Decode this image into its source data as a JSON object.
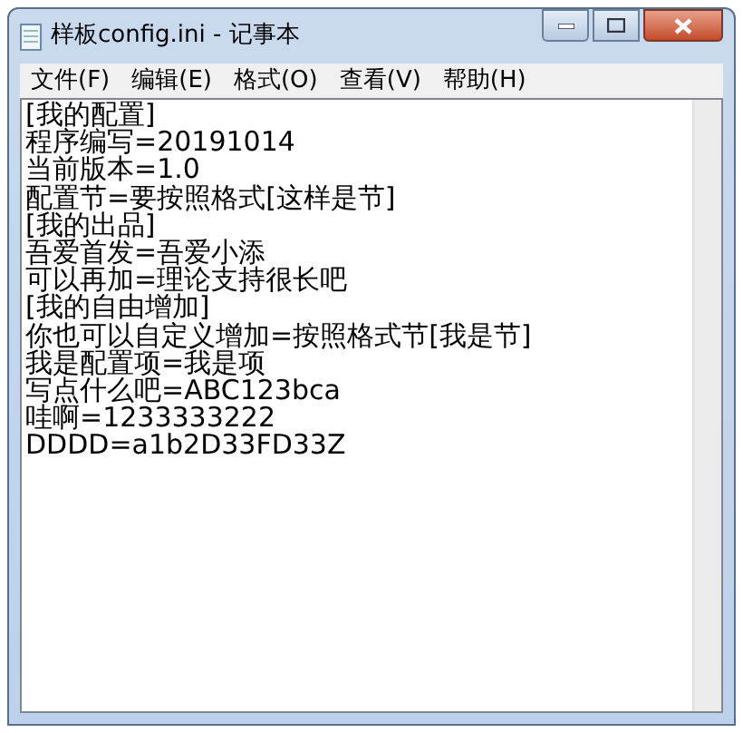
{
  "window": {
    "title": "样板config.ini - 记事本"
  },
  "menu": [
    {
      "label": "文件(F)"
    },
    {
      "label": "编辑(E)"
    },
    {
      "label": "格式(O)"
    },
    {
      "label": "查看(V)"
    },
    {
      "label": "帮助(H)"
    }
  ],
  "editor": {
    "lines": [
      "[我的配置]",
      "程序编写=20191014",
      "当前版本=1.0",
      "配置节=要按照格式[这样是节]",
      "[我的出品]",
      "吾爱首发=吾爱小添",
      "可以再加=理论支持很长吧",
      "[我的自由增加]",
      "你也可以自定义增加=按照格式节[我是节]",
      "我是配置项=我是项",
      "写点什么吧=ABC123bca",
      "哇啊=1233333222",
      "DDDD=a1b2D33FD33Z"
    ]
  }
}
